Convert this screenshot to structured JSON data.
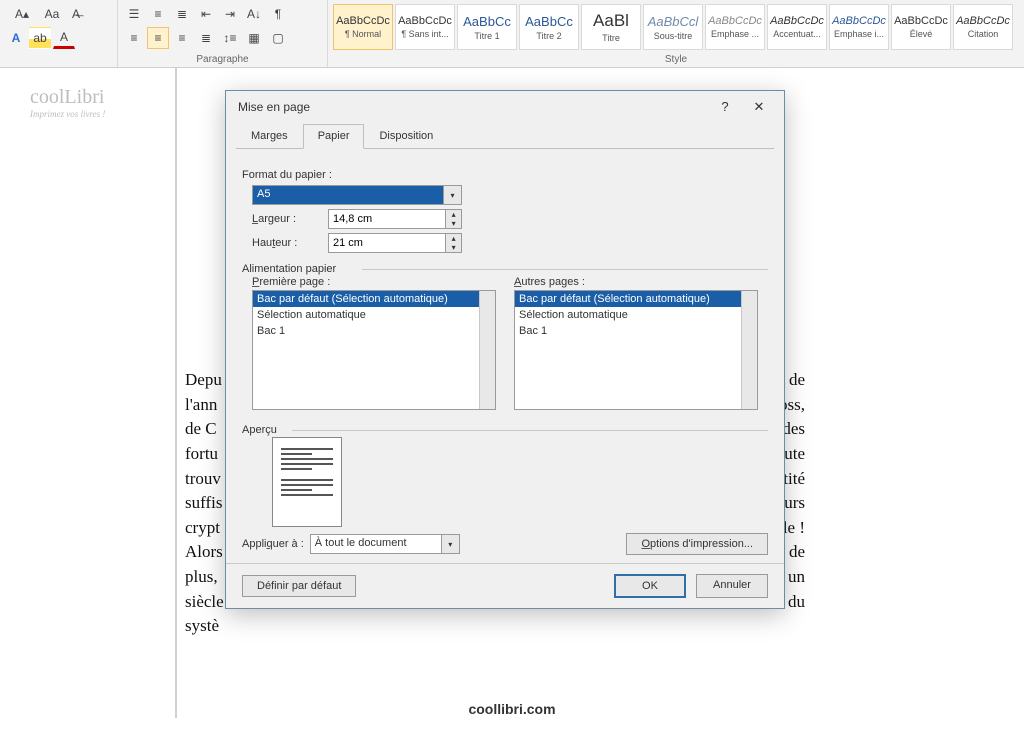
{
  "ribbon": {
    "group_font_label": "",
    "group_para_label": "Paragraphe",
    "group_style_label": "Style",
    "styles": [
      {
        "sample": "AaBbCcDc",
        "name": "¶ Normal",
        "color": "#333",
        "italic": false,
        "selected": true
      },
      {
        "sample": "AaBbCcDc",
        "name": "¶ Sans int...",
        "color": "#333",
        "italic": false,
        "selected": false
      },
      {
        "sample": "AaBbCc",
        "name": "Titre 1",
        "color": "#2b5797",
        "italic": false,
        "selected": false
      },
      {
        "sample": "AaBbCc",
        "name": "Titre 2",
        "color": "#2b5797",
        "italic": false,
        "selected": false
      },
      {
        "sample": "AaBl",
        "name": "Titre",
        "color": "#333",
        "italic": false,
        "selected": false
      },
      {
        "sample": "AaBbCcl",
        "name": "Sous-titre",
        "color": "#6f8aa8",
        "italic": true,
        "selected": false
      },
      {
        "sample": "AaBbCcDc",
        "name": "Emphase ...",
        "color": "#888",
        "italic": true,
        "selected": false
      },
      {
        "sample": "AaBbCcDc",
        "name": "Accentuat...",
        "color": "#333",
        "italic": true,
        "selected": false
      },
      {
        "sample": "AaBbCcDc",
        "name": "Emphase i...",
        "color": "#2b5797",
        "italic": true,
        "selected": false
      },
      {
        "sample": "AaBbCcDc",
        "name": "Élevé",
        "color": "#333",
        "italic": false,
        "selected": false
      },
      {
        "sample": "AaBbCcDc",
        "name": "Citation",
        "color": "#333",
        "italic": true,
        "selected": false
      }
    ]
  },
  "watermark": {
    "brand": "coolLibri",
    "tagline": "Imprimez vos livres !"
  },
  "document": {
    "body_lines": [
      [
        "Depu",
        "fin de"
      ],
      [
        "l'ann",
        "evoss,"
      ],
      [
        "de C",
        "sé des"
      ],
      [
        "fortu",
        "e toute"
      ],
      [
        "trouv",
        "uantité"
      ],
      [
        "suffis",
        "t leurs"
      ],
      [
        "crypt",
        "acile !"
      ],
      [
        "Alors",
        "urs de"
      ],
      [
        "plus,",
        "w, un"
      ],
      [
        "siècle",
        "ne du"
      ],
      [
        "systè",
        ""
      ]
    ]
  },
  "footer_brand": "coollibri.com",
  "dialog": {
    "title": "Mise en page",
    "tabs": {
      "marges": "Marges",
      "papier": "Papier",
      "disposition": "Disposition"
    },
    "paper": {
      "format_label": "Format du papier :",
      "format_value": "A5",
      "largeur_label": "Largeur :",
      "largeur_value": "14,8 cm",
      "hauteur_label": "Hauteur :",
      "hauteur_value": "21 cm"
    },
    "feed": {
      "section_label": "Alimentation papier",
      "first_label": "Première page :",
      "other_label": "Autres pages :",
      "options": [
        "Bac par défaut (Sélection automatique)",
        "Sélection automatique",
        "Bac 1"
      ],
      "selected_index": 0
    },
    "preview_label": "Aperçu",
    "apply": {
      "label": "Appliquer à :",
      "value": "À tout le document",
      "print_options": "Options d'impression..."
    },
    "buttons": {
      "default": "Définir par défaut",
      "ok": "OK",
      "cancel": "Annuler"
    }
  }
}
